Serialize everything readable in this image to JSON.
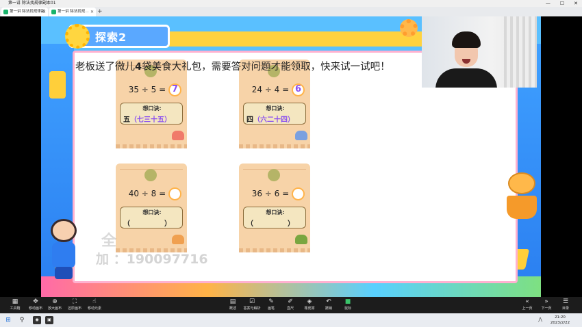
{
  "window": {
    "title": "第一讲 除法找规律副本01",
    "controls": [
      "—",
      "☐",
      "✕"
    ]
  },
  "tabs": [
    {
      "label": "第一讲 除法找规律副本01",
      "close": "✕"
    },
    {
      "label": "第一讲 除法找规…",
      "close": "✕"
    }
  ],
  "tab_add": "+",
  "slide": {
    "badge": "探索2",
    "headline_pre": "老板送了微儿",
    "headline_num": "4",
    "headline_post": "袋美食大礼包，需要答对问题才能领取，快来试一试吧！",
    "tip_title": "想口诀:",
    "bags": [
      {
        "equation": "35 ÷ 5 =",
        "answer": "7",
        "answer_color": "#8a4ff0",
        "rhyme_prefix": "五",
        "rhyme": "（七三十五）",
        "burger_color": "#f07a6a"
      },
      {
        "equation": "24 ÷ 4 =",
        "answer": "6",
        "answer_color": "#8a4ff0",
        "rhyme_prefix": "四",
        "rhyme": "（六二十四）",
        "burger_color": "#7aa0e0"
      },
      {
        "equation": "40 ÷ 8 =",
        "answer": "",
        "answer_color": "#8a4ff0",
        "rhyme_prefix": "",
        "rhyme": "（　　　　　）",
        "burger_color": "#f0a050"
      },
      {
        "equation": "36 ÷ 6 =",
        "answer": "",
        "answer_color": "#8a4ff0",
        "rhyme_prefix": "",
        "rhyme": "（　　　　　）",
        "burger_color": "#7aa640"
      }
    ],
    "watermark_line1": "全",
    "watermark_line2": "加        ：190097716"
  },
  "toolbar": {
    "left": [
      {
        "icon": "▦",
        "label": "工具箱"
      },
      {
        "icon": "✥",
        "label": "移动画布"
      },
      {
        "icon": "⊕",
        "label": "放大画布"
      },
      {
        "icon": "⛶",
        "label": "还原画布"
      },
      {
        "icon": "☝",
        "label": "移动元素"
      }
    ],
    "center": [
      {
        "icon": "▤",
        "label": "概述"
      },
      {
        "icon": "☑",
        "label": "答案与解析"
      },
      {
        "icon": "✎",
        "label": "画笔"
      },
      {
        "icon": "✐",
        "label": "直尺"
      },
      {
        "icon": "◈",
        "label": "橡皮擦"
      },
      {
        "icon": "↶",
        "label": "撤销"
      },
      {
        "icon": "■",
        "label": "鼠标"
      }
    ],
    "right": [
      {
        "icon": "«",
        "label": "上一页"
      },
      {
        "icon": "»",
        "label": "下一页"
      },
      {
        "icon": "☰",
        "label": "目录"
      }
    ]
  },
  "taskbar": {
    "start": "⊞",
    "search": "⚲",
    "apps": [
      "◉",
      "▣"
    ],
    "time": "21:20",
    "date": "2023/2/22",
    "tray": "⋀"
  }
}
